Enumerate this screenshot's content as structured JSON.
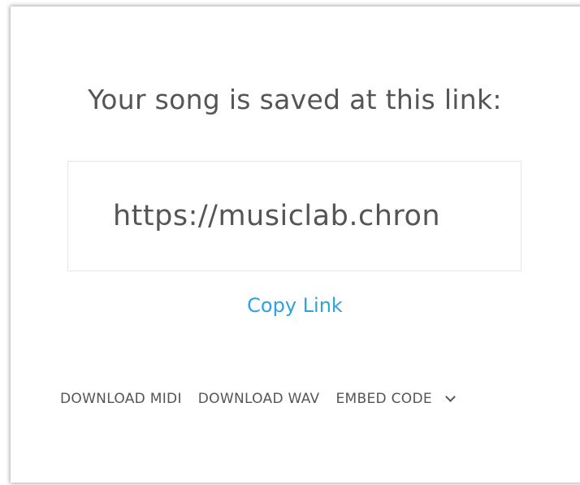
{
  "dialog": {
    "heading": "Your song is saved at this link:",
    "link_value": "https://musiclab.chron",
    "copy_link_label": "Copy Link",
    "actions": {
      "download_midi": "DOWNLOAD MIDI",
      "download_wav": "DOWNLOAD WAV",
      "embed_code": "EMBED CODE"
    },
    "embed_icon": "chevron-down-icon"
  },
  "colors": {
    "accent": "#2ba3e0",
    "text": "#555555",
    "border": "#e6e6e6"
  }
}
